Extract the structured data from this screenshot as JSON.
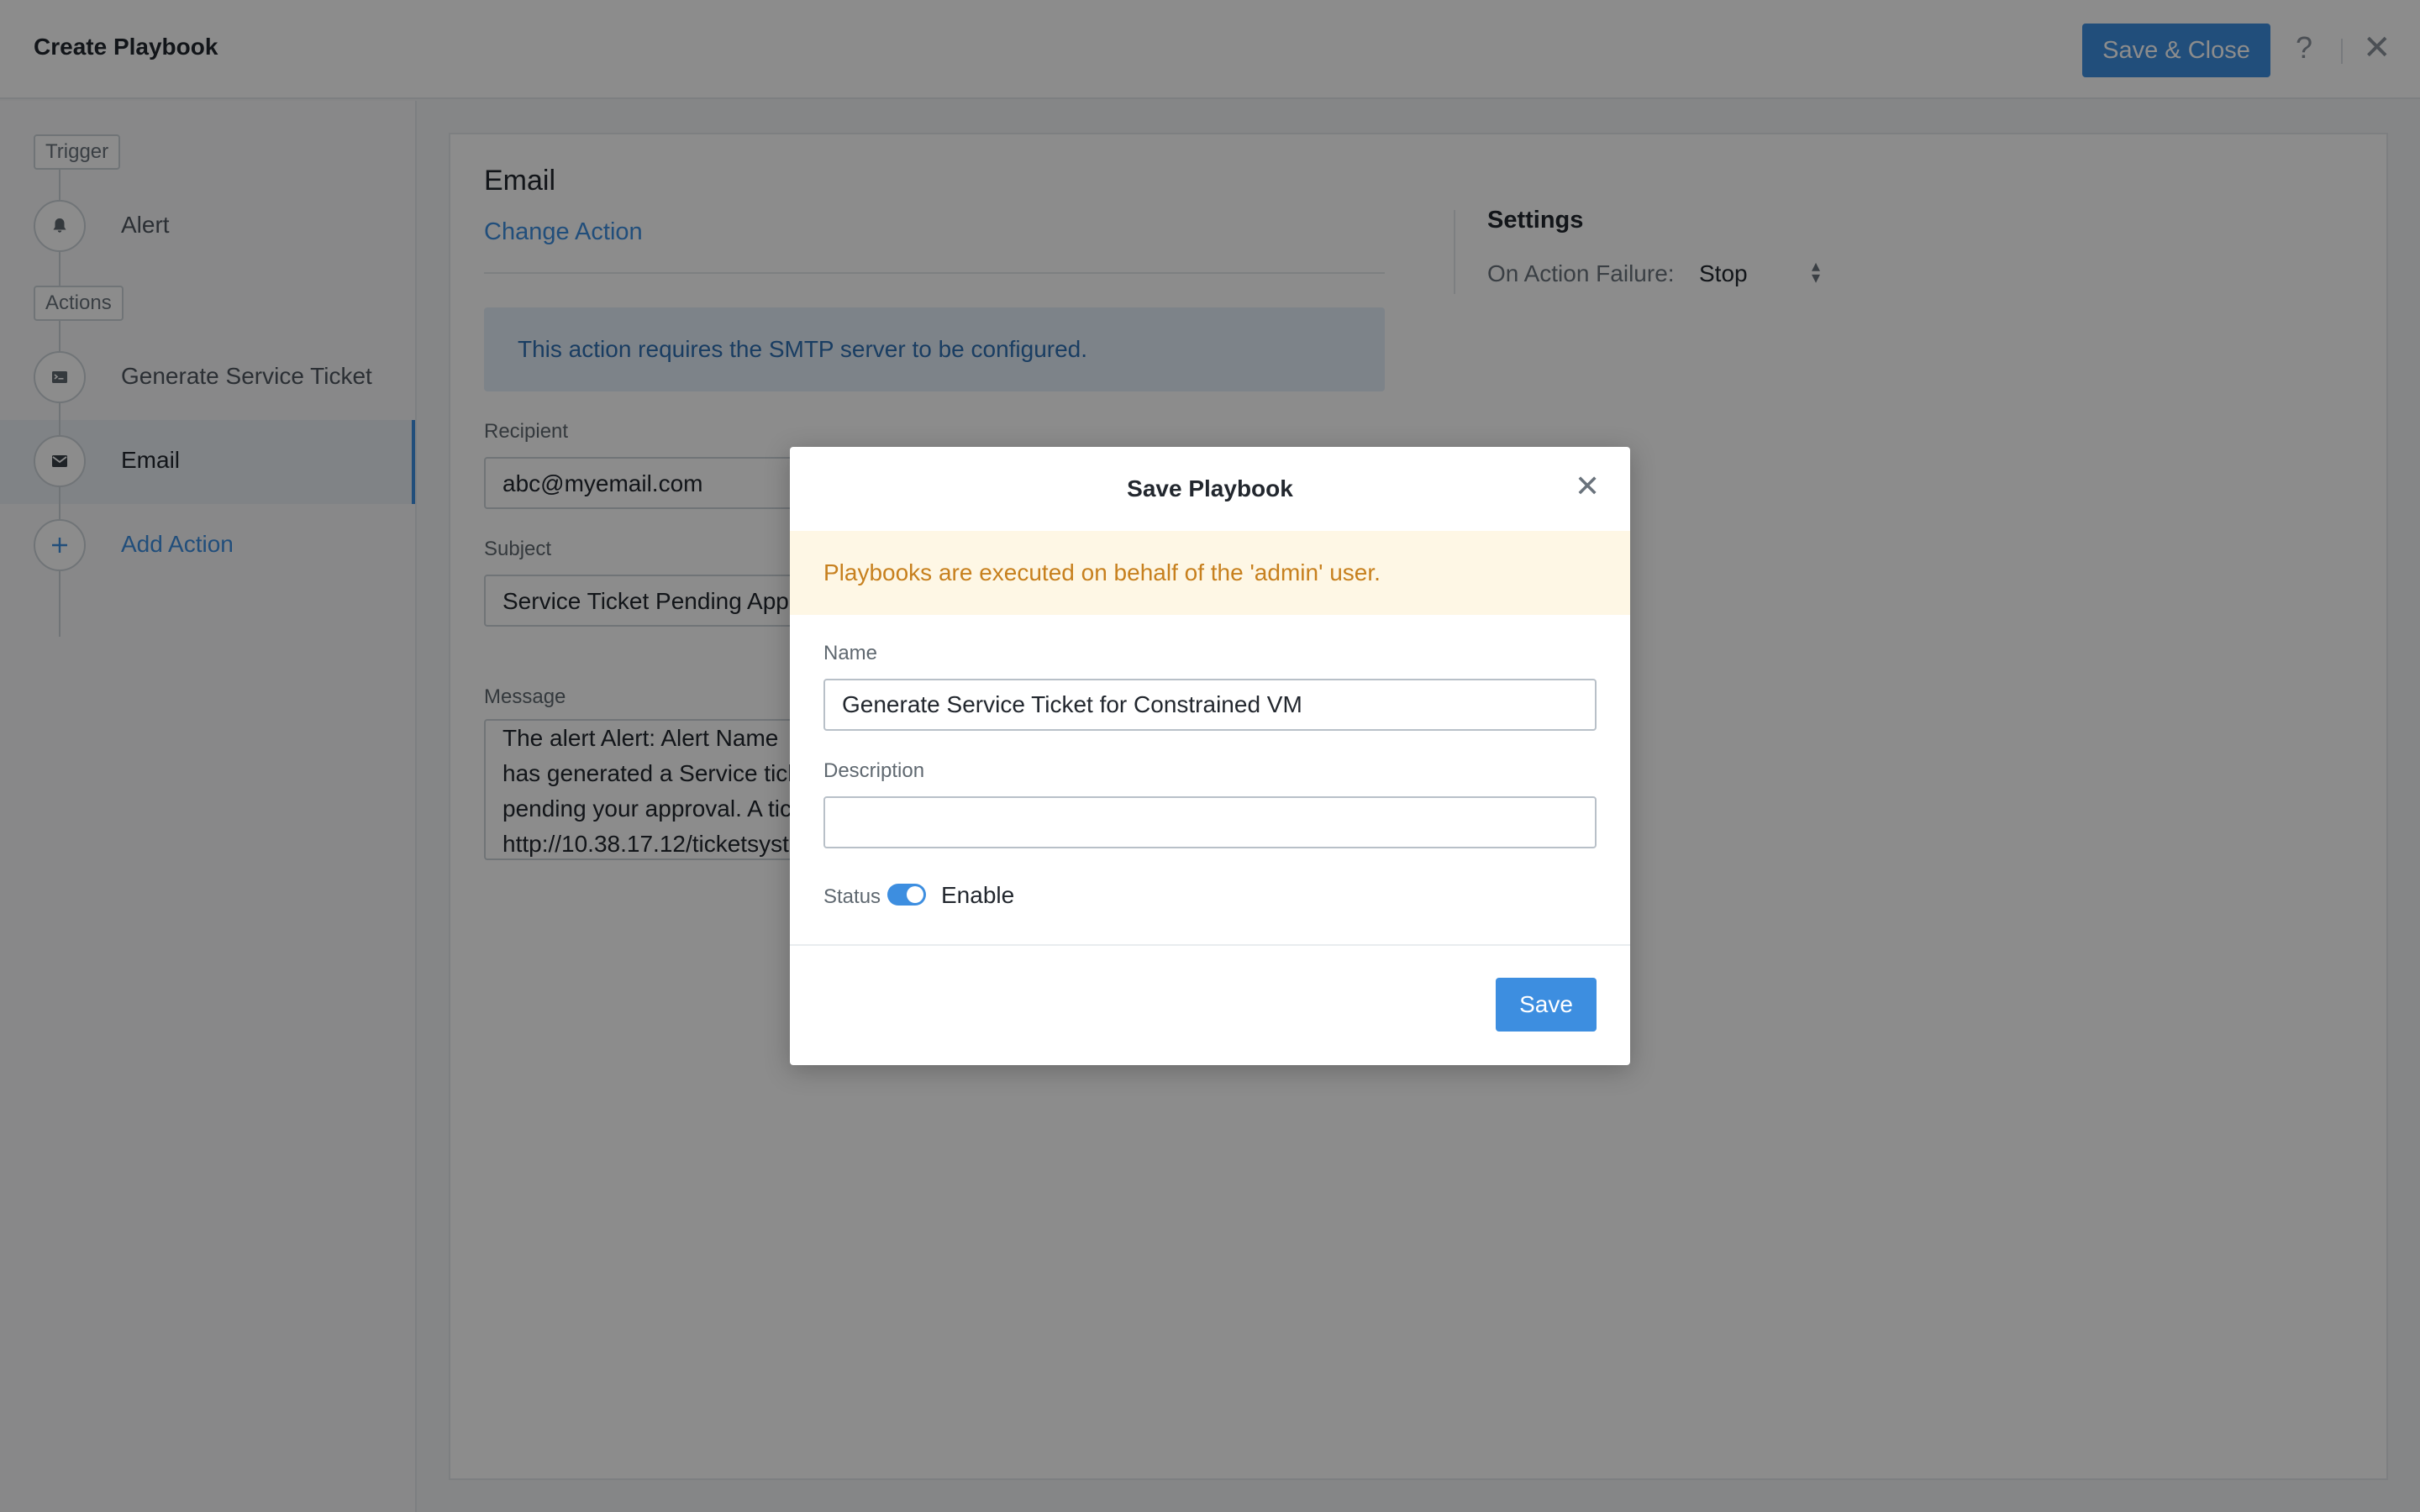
{
  "header": {
    "title": "Create Playbook",
    "save_close_label": "Save & Close",
    "help_symbol": "?",
    "close_symbol": "✕"
  },
  "sidebar": {
    "trigger_tag": "Trigger",
    "actions_tag": "Actions",
    "items": [
      {
        "label": "Alert",
        "icon": "bell-icon"
      },
      {
        "label": "Generate Service Ticket",
        "icon": "ticket-icon"
      },
      {
        "label": "Email",
        "icon": "envelope-icon",
        "active": true
      },
      {
        "label": "Add Action",
        "icon": "plus-icon"
      }
    ]
  },
  "main": {
    "action_title": "Email",
    "change_action": "Change Action",
    "settings": {
      "title": "Settings",
      "failure_label": "On Action Failure:",
      "failure_value": "Stop"
    },
    "info": "This action requires the SMTP server to be configured.",
    "recipient_label": "Recipient",
    "recipient_value": "abc@myemail.com",
    "subject_label": "Subject",
    "subject_value": "Service Ticket Pending Appr",
    "message_label": "Message",
    "message_lines": [
      "The alert  Alert: Alert Name",
      "has generated a Service tick",
      "pending your approval. A tic",
      "http://10.38.17.12/ticketsystem"
    ]
  },
  "modal": {
    "title": "Save Playbook",
    "close_symbol": "✕",
    "warning": "Playbooks are executed on behalf of the 'admin' user.",
    "name_label": "Name",
    "name_value": "Generate Service Ticket for Constrained VM",
    "description_label": "Description",
    "description_value": "",
    "status_label": "Status",
    "status_value": "Enable",
    "save_label": "Save"
  },
  "colors": {
    "accent": "#3d8ee0",
    "warning_text": "#c7801e",
    "warning_bg": "#fef7e5",
    "info_bg": "#e4eff9"
  }
}
